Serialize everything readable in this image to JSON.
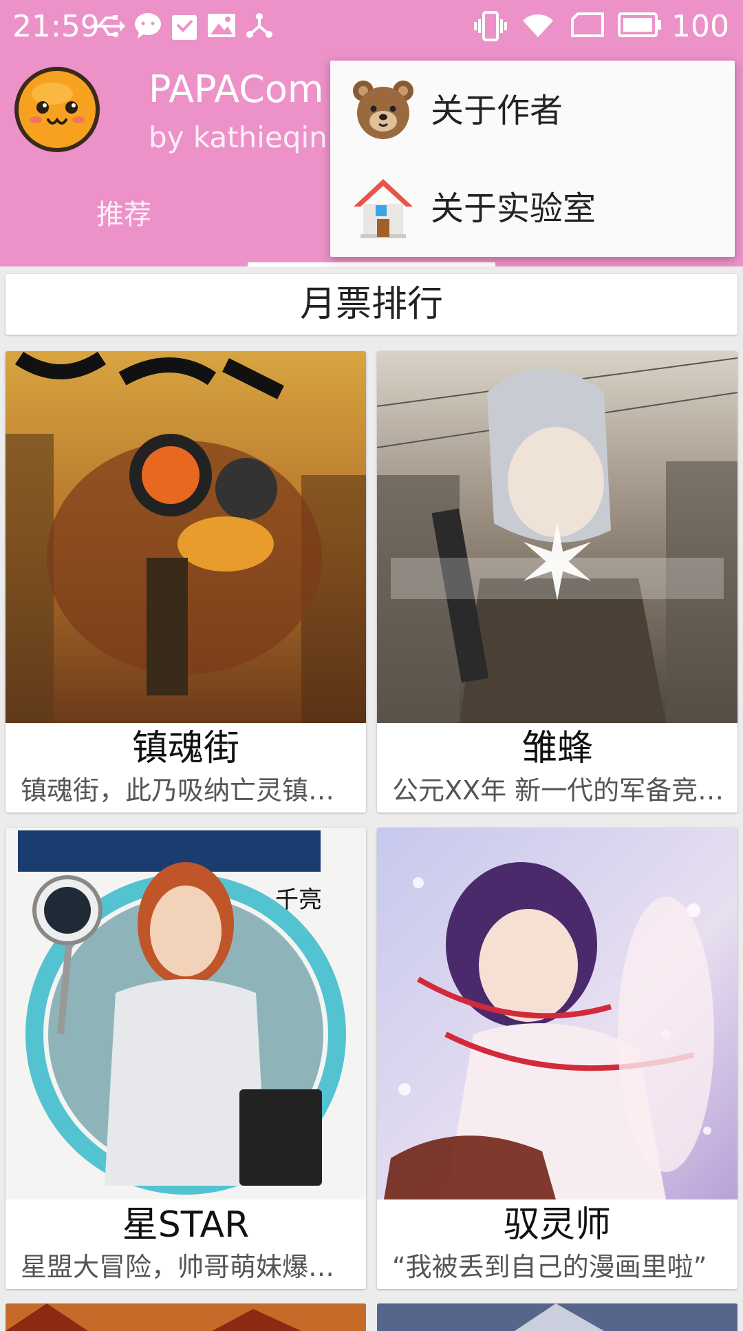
{
  "status_bar": {
    "time": "21:59",
    "battery": "100",
    "icons": [
      "usb-icon",
      "wechat-icon",
      "bag-icon",
      "image-icon",
      "share-icon",
      "vibrate-icon",
      "wifi-icon",
      "sim-icon",
      "battery-icon"
    ]
  },
  "header": {
    "title": "PAPACom",
    "subtitle": "by kathieqin",
    "tabs": [
      {
        "label": "推荐"
      }
    ]
  },
  "menu": {
    "items": [
      {
        "label": "关于作者",
        "icon": "bear-icon"
      },
      {
        "label": "关于实验室",
        "icon": "house-icon"
      }
    ]
  },
  "section": {
    "title": "月票排行"
  },
  "comics": [
    {
      "title": "镇魂街",
      "desc": "镇魂街，此乃吸纳亡灵镇压恶灵之地"
    },
    {
      "title": "雏蜂",
      "desc": "公元XX年 新一代的军备竞赛开始了"
    },
    {
      "title": "星STAR",
      "desc": "星盟大冒险，帅哥萌妹爆笑登场"
    },
    {
      "title": "驭灵师",
      "desc": "“我被丢到自己的漫画里啦”"
    }
  ],
  "colors": {
    "accent": "#ec92c9",
    "background": "#ececec",
    "menu_bg": "#fafafa"
  }
}
